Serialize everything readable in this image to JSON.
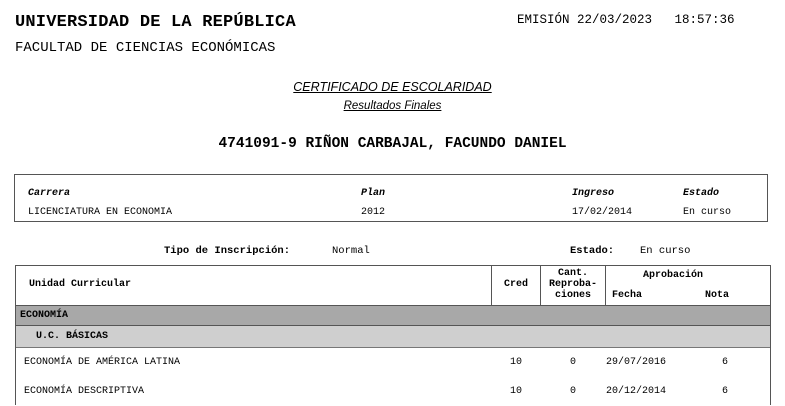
{
  "header": {
    "university": "UNIVERSIDAD DE LA REPÚBLICA",
    "faculty": "FACULTAD DE CIENCIAS ECONÓMICAS",
    "emission": "EMISIÓN 22/03/2023   18:57:36"
  },
  "certificate": {
    "title": "CERTIFICADO DE ESCOLARIDAD",
    "subtitle": "Resultados Finales"
  },
  "student": {
    "id_name": "4741091-9 RIÑON CARBAJAL, FACUNDO DANIEL"
  },
  "career_box": {
    "headers": {
      "career": "Carrera",
      "plan": "Plan",
      "entry": "Ingreso",
      "status": "Estado"
    },
    "values": {
      "career": "LICENCIATURA EN ECONOMIA",
      "plan": "2012",
      "entry": "17/02/2014",
      "status": "En curso"
    }
  },
  "inscription": {
    "type_label": "Tipo de Inscripción:",
    "type_value": "Normal",
    "state_label": "Estado:",
    "state_value": "En curso"
  },
  "table": {
    "headers": {
      "unit": "Unidad Curricular",
      "cred": "Cred",
      "rep_line1": "Cant.",
      "rep_line2": "Reproba-",
      "rep_line3": "ciones",
      "approval": "Aprobación",
      "date": "Fecha",
      "grade": "Nota"
    },
    "section": "ECONOMÍA",
    "subsection": "U.C. BÁSICAS",
    "rows": [
      {
        "unit": "ECONOMÍA DE AMÉRICA LATINA",
        "cred": "10",
        "rep": "0",
        "date": "29/07/2016",
        "grade": "6"
      },
      {
        "unit": "ECONOMÍA DESCRIPTIVA",
        "cred": "10",
        "rep": "0",
        "date": "20/12/2014",
        "grade": "6"
      }
    ]
  }
}
